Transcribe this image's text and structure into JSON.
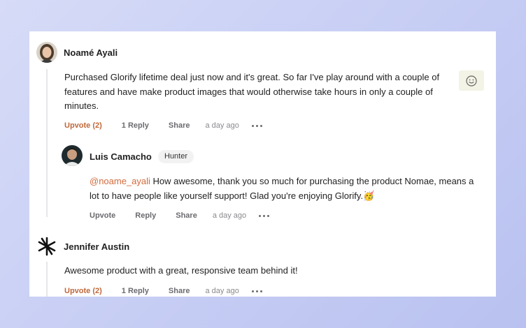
{
  "comments": [
    {
      "author": "Noamé Ayali",
      "text": "Purchased Glorify lifetime deal just now and it's great. So far I've play around with a couple of features and have make product images that would otherwise take hours in only a couple of minutes.",
      "upvote": "Upvote (2)",
      "reply": "1 Reply",
      "share": "Share",
      "time": "a day ago"
    },
    {
      "author": "Luis Camacho",
      "badge": "Hunter",
      "mention": "@noame_ayali",
      "text": " How awesome, thank you so much for purchasing the product Nomae, means a lot to have people like yourself support! Glad you're enjoying Glorify.",
      "upvote": "Upvote",
      "reply": "Reply",
      "share": "Share",
      "time": "a day ago"
    },
    {
      "author": "Jennifer Austin",
      "text": "Awesome product with a great, responsive team behind it!",
      "upvote": "Upvote (2)",
      "reply": "1 Reply",
      "share": "Share",
      "time": "a day ago"
    }
  ],
  "icons": {
    "emoji_button": "smiley-face-icon",
    "party_emoji": "🥳",
    "more": "more-dots-icon"
  },
  "colors": {
    "accent": "#c0683b",
    "mention": "#d26a3b"
  }
}
